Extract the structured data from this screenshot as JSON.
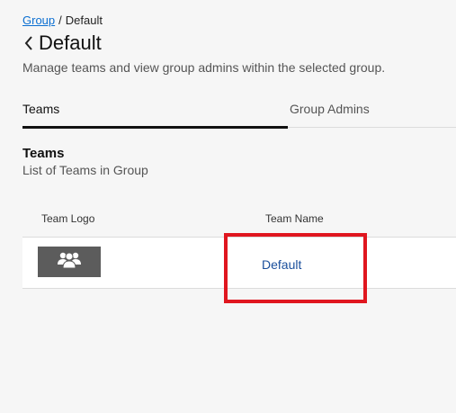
{
  "breadcrumb": {
    "parent": "Group",
    "separator": "/",
    "current": "Default"
  },
  "header": {
    "title": "Default",
    "back_icon": "chevron-left-icon",
    "subtitle": "Manage teams and view group admins within the selected group."
  },
  "tabs": [
    {
      "label": "Teams",
      "active": true
    },
    {
      "label": "Group Admins",
      "active": false
    }
  ],
  "section": {
    "title": "Teams",
    "description": "List of Teams in Group"
  },
  "table": {
    "columns": [
      "Team Logo",
      "Team Name"
    ],
    "rows": [
      {
        "logo_icon": "team-group-icon",
        "name": "Default"
      }
    ]
  },
  "colors": {
    "link": "#0a6ed1",
    "team_link": "#1a4f9c",
    "highlight": "#e0161f",
    "logo_bg": "#5c5c5c"
  }
}
